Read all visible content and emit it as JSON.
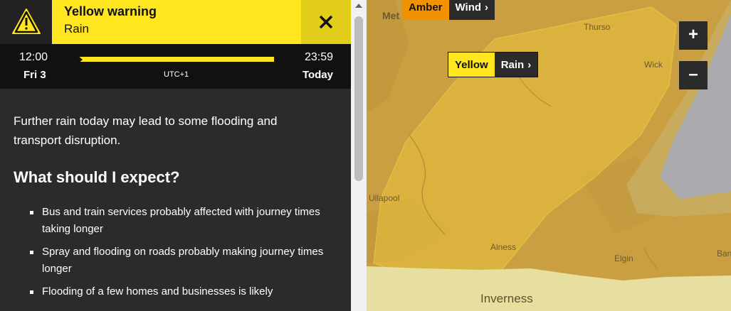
{
  "warning": {
    "level": "Yellow warning",
    "type": "Rain"
  },
  "timeline": {
    "start_time": "12:00",
    "start_day": "Fri 3",
    "end_time": "23:59",
    "end_day": "Today",
    "timezone": "UTC+1"
  },
  "content": {
    "summary": "Further rain today may lead to some flooding and transport disruption.",
    "expect_heading": "What should I expect?",
    "expect_items": [
      "Bus and train services probably affected with journey times taking longer",
      "Spray and flooding on roads probably making journey times longer",
      "Flooding of a few homes and businesses is likely"
    ]
  },
  "map": {
    "logo": "Met Office",
    "places": {
      "thurso": "Thurso",
      "wick": "Wick",
      "ullapool": "Ullapool",
      "alness": "Alness",
      "elgin": "Elgin",
      "inverness": "Inverness",
      "banff": "Ban"
    },
    "chips": {
      "amber_level": "Amber",
      "amber_type": "Wind",
      "yellow_level": "Yellow",
      "yellow_type": "Rain"
    },
    "zoom_in": "+",
    "zoom_out": "–"
  },
  "icons": {
    "warning": "warning-triangle-icon",
    "close": "close-icon",
    "chevron": "chevron-right-icon"
  },
  "colors": {
    "yellow": "#ffe61e",
    "amber": "#f29200",
    "panel": "#2b2b2b",
    "timeline": "#111111"
  }
}
